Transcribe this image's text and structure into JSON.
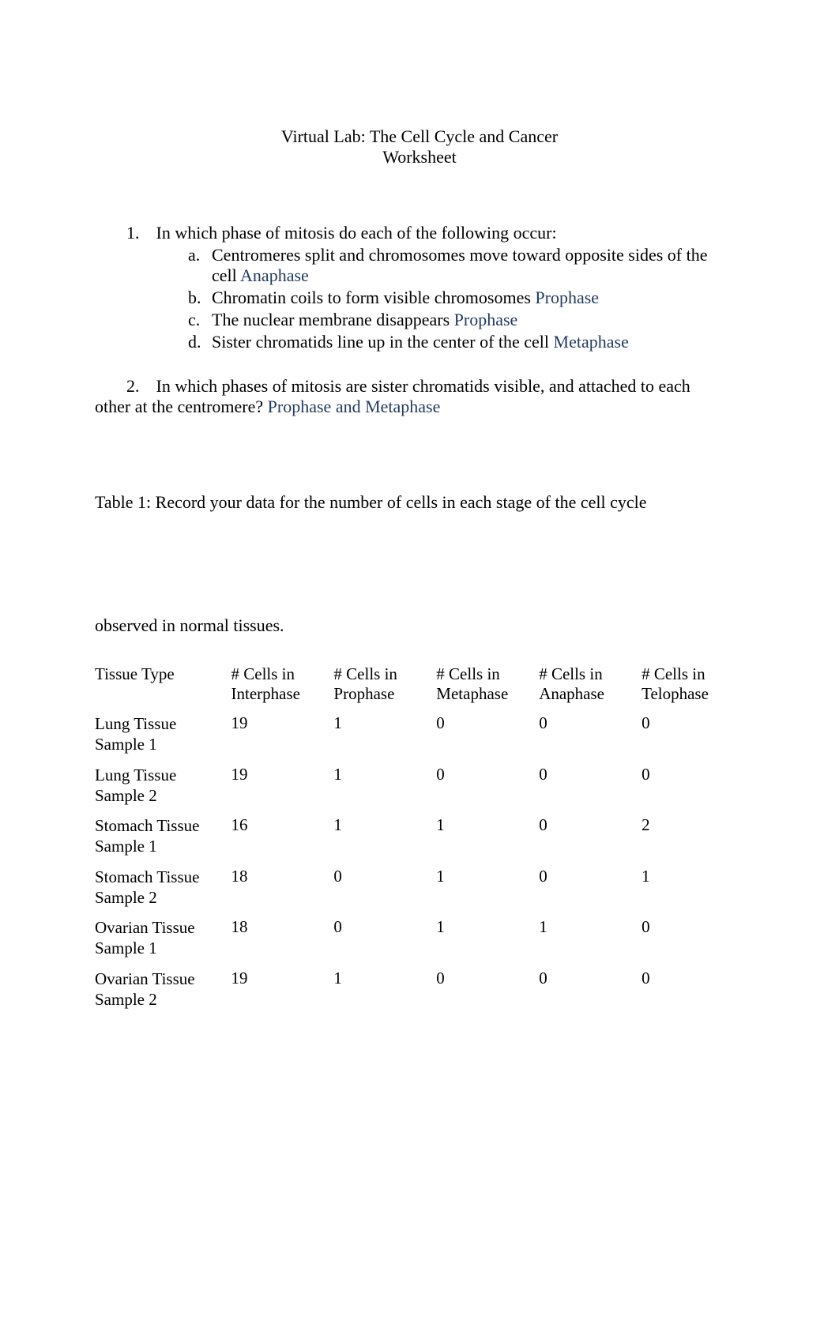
{
  "title": {
    "line1": "Virtual Lab:    The Cell Cycle and Cancer",
    "line2": "Worksheet"
  },
  "q1": {
    "number": "1.",
    "intro": "In which phase of mitosis do each of the following occur:",
    "items": [
      {
        "letter": "a.",
        "text_line1": "Centromeres split and chromosomes move toward opposite sides of the",
        "text_line2_prefix": "cell ",
        "answer": "Anaphase"
      },
      {
        "letter": "b.",
        "text": "Chromatin coils to form visible chromosomes ",
        "answer": "Prophase"
      },
      {
        "letter": "c.",
        "text": "The nuclear membrane disappears ",
        "answer": "Prophase"
      },
      {
        "letter": "d.",
        "text": "Sister chromatids line up in the center of the cell ",
        "answer": "Metaphase"
      }
    ]
  },
  "q2": {
    "number": "2.",
    "text_part1": "In which phases of mitosis are sister chromatids visible, and attached to each",
    "text_part2_prefix": "other at the centromere? ",
    "answer": "Prophase and Metaphase"
  },
  "table1_label": "Table 1:   Record your data for the number of cells in each stage of the cell cycle",
  "observed_line": "observed in normal tissues.",
  "table": {
    "headers": {
      "tissue": "Tissue Type",
      "interphase_l1": "# Cells in",
      "interphase_l2": "Interphase",
      "prophase_l1": "# Cells in",
      "prophase_l2": "Prophase",
      "metaphase_l1": "# Cells in",
      "metaphase_l2": "Metaphase",
      "anaphase_l1": "# Cells in",
      "anaphase_l2": "Anaphase",
      "telophase_l1": "# Cells in",
      "telophase_l2": "Telophase"
    },
    "rows": [
      {
        "tissue_l1": "Lung Tissue",
        "tissue_l2": "Sample 1",
        "interphase": "19",
        "prophase": "1",
        "metaphase": "0",
        "anaphase": "0",
        "telophase": "0"
      },
      {
        "tissue_l1": "Lung Tissue",
        "tissue_l2": "Sample 2",
        "interphase": "19",
        "prophase": "1",
        "metaphase": "0",
        "anaphase": "0",
        "telophase": "0"
      },
      {
        "tissue_l1": "Stomach Tissue",
        "tissue_l2": "Sample 1",
        "interphase": "16",
        "prophase": "1",
        "metaphase": "1",
        "anaphase": "0",
        "telophase": "2"
      },
      {
        "tissue_l1": "Stomach Tissue",
        "tissue_l2": "Sample 2",
        "interphase": "18",
        "prophase": "0",
        "metaphase": "1",
        "anaphase": "0",
        "telophase": "1"
      },
      {
        "tissue_l1": "Ovarian Tissue",
        "tissue_l2": "Sample 1",
        "interphase": "18",
        "prophase": "0",
        "metaphase": "1",
        "anaphase": "1",
        "telophase": "0"
      },
      {
        "tissue_l1": "Ovarian Tissue",
        "tissue_l2": "Sample 2",
        "interphase": "19",
        "prophase": "1",
        "metaphase": "0",
        "anaphase": "0",
        "telophase": "0"
      }
    ]
  }
}
